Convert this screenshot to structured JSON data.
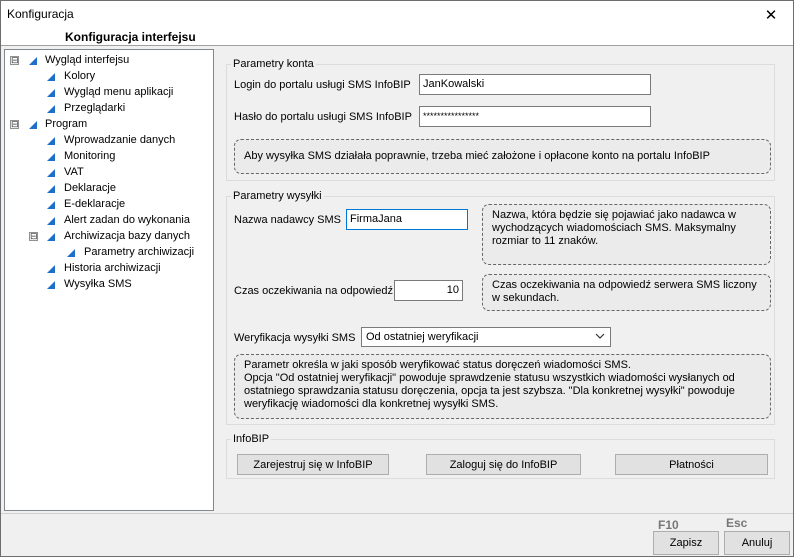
{
  "window": {
    "title": "Konfiguracja",
    "close_glyph": "✕"
  },
  "header": {
    "title": "Konfiguracja interfejsu"
  },
  "tree": {
    "items": [
      {
        "label": "Wygląd interfejsu",
        "expander": "⊟"
      },
      {
        "label": "Kolory"
      },
      {
        "label": "Wygląd menu aplikacji"
      },
      {
        "label": "Przeglądarki"
      },
      {
        "label": "Program",
        "expander": "⊟"
      },
      {
        "label": "Wprowadzanie danych"
      },
      {
        "label": "Monitoring"
      },
      {
        "label": "VAT"
      },
      {
        "label": "Deklaracje"
      },
      {
        "label": "E-deklaracje"
      },
      {
        "label": "Alert zadan do wykonania"
      },
      {
        "label": "Archiwizacja bazy danych",
        "expander": "⊟"
      },
      {
        "label": "Parametry archiwizacji"
      },
      {
        "label": "Historia archiwizacji"
      },
      {
        "label": "Wysyłka SMS"
      }
    ]
  },
  "account": {
    "title": "Parametry konta",
    "login_label": "Login do portalu usługi SMS InfoBIP",
    "login_value": "JanKowalski",
    "password_label": "Hasło do portalu usługi SMS InfoBIP",
    "password_value": "****************",
    "note": "Aby wysyłka SMS działała poprawnie, trzeba mieć założone i opłacone konto na portalu InfoBIP"
  },
  "send": {
    "title": "Parametry wysyłki",
    "sender_label": "Nazwa nadawcy SMS",
    "sender_value": "FirmaJana",
    "sender_note": "Nazwa, która będzie się pojawiać jako nadawca w wychodzących wiadomościach SMS. Maksymalny rozmiar to 11 znaków.",
    "timeout_label": "Czas oczekiwania na odpowiedź",
    "timeout_value": "10",
    "timeout_note": "Czas oczekiwania na odpowiedź serwera SMS liczony w sekundach.",
    "verify_label": "Weryfikacja wysyłki SMS",
    "verify_value": "Od ostatniej weryfikacji",
    "verify_note": "Parametr określa w jaki sposób weryfikować status doręczeń wiadomości SMS.\nOpcja \"Od ostatniej weryfikacji\" powoduje sprawdzenie statusu wszystkich wiadomości wysłanych od ostatniego sprawdzania statusu doręczenia, opcja ta jest szybsza. \"Dla konkretnej wysyłki\" powoduje weryfikację wiadomości dla konkretnej wysyłki SMS."
  },
  "infobip": {
    "title": "InfoBIP",
    "register_label": "Zarejestruj się w InfoBIP",
    "login_label": "Zaloguj się do InfoBIP",
    "payments_label": "Płatności"
  },
  "footer": {
    "save_key": "F10",
    "save_label": "Zapisz",
    "cancel_key": "Esc",
    "cancel_label": "Anuluj"
  },
  "colors": {
    "tree_arrow": "#1e6fc9",
    "focus_border": "#0078d7"
  }
}
